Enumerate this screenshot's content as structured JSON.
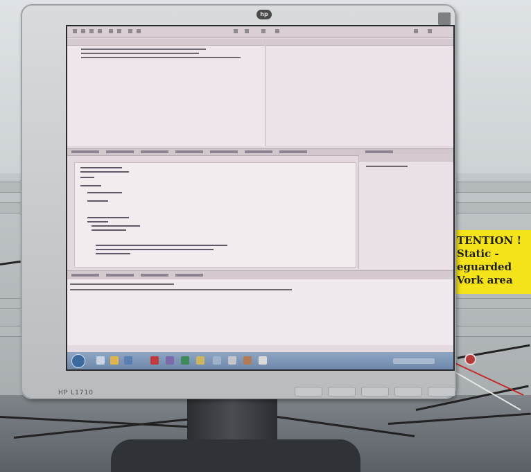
{
  "sign": {
    "line1": "TENTION !",
    "line2": "Static -",
    "line3": "eguarded",
    "line4": "Vork area"
  },
  "monitor": {
    "model_label": "HP L1710",
    "logo_text": "hp"
  }
}
